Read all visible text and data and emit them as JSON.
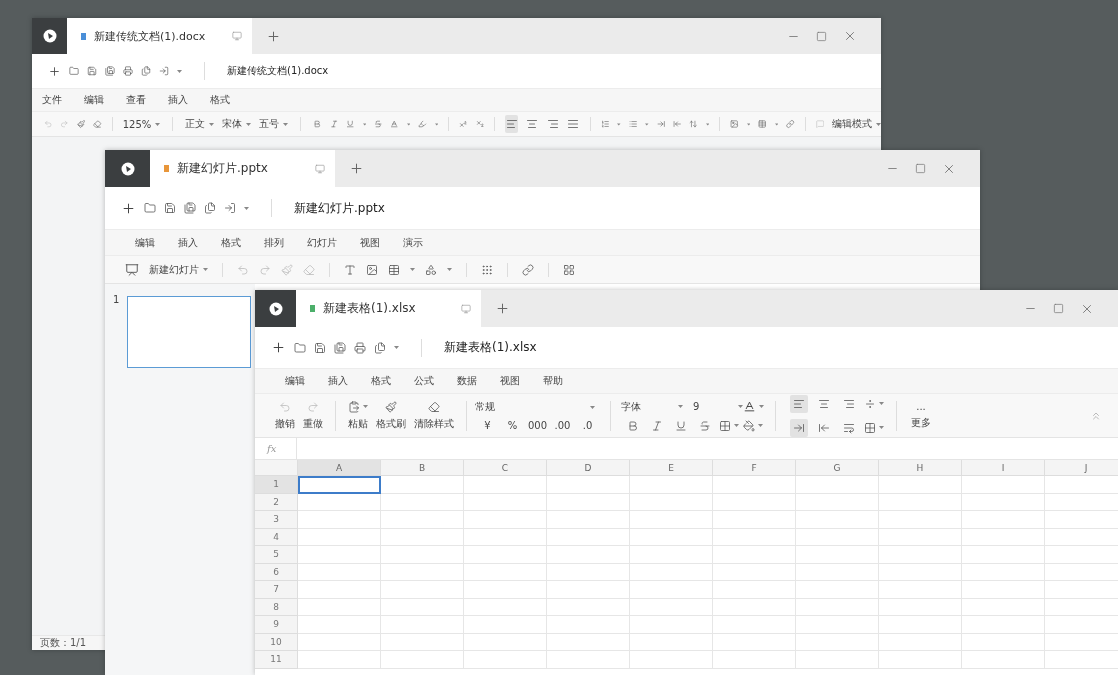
{
  "document_window": {
    "tab": {
      "title": "新建传统文档(1).docx",
      "color": "#4a8fd8"
    },
    "file_name": "新建传统文档(1).docx",
    "menu": [
      "文件",
      "编辑",
      "查看",
      "插入",
      "格式"
    ],
    "zoom": "125%",
    "paragraph_style": "正文",
    "font": "宋体",
    "font_size": "五号",
    "align_buttons": [
      {
        "selected": true
      },
      {
        "selected": false
      },
      {
        "selected": false
      },
      {
        "selected": false
      }
    ],
    "mode": "编辑模式",
    "status": "页数：1/1"
  },
  "presentation_window": {
    "tab": {
      "title": "新建幻灯片.pptx",
      "color": "#e8963a"
    },
    "file_name": "新建幻灯片.pptx",
    "menu": [
      "编辑",
      "插入",
      "格式",
      "排列",
      "幻灯片",
      "视图",
      "演示"
    ],
    "new_slide": "新建幻灯片",
    "slides": [
      {
        "number": "1",
        "selected": true
      }
    ]
  },
  "spreadsheet_window": {
    "tab": {
      "title": "新建表格(1).xlsx",
      "color": "#4caf6a"
    },
    "file_name": "新建表格(1).xlsx",
    "menu": [
      "编辑",
      "插入",
      "格式",
      "公式",
      "数据",
      "视图",
      "帮助"
    ],
    "ribbon": {
      "undo": "撤销",
      "redo": "重做",
      "paste": "粘贴",
      "format_painter": "格式刷",
      "clear": "清除样式",
      "number_format": "常规",
      "currency": "¥",
      "percent": "%",
      "thousands": "000",
      "decimal_more": ".00",
      "decimal_less": ".0",
      "font": "字体",
      "font_size": "9",
      "more_dots": "...",
      "more": "更多"
    },
    "align_buttons": [
      {
        "selected": true
      },
      {
        "selected": false
      },
      {
        "selected": false
      },
      {
        "selected": true
      },
      {
        "selected": false
      },
      {
        "selected": false
      }
    ],
    "formula_label": "fx",
    "columns": [
      {
        "label": "A",
        "selected": true
      },
      {
        "label": "B",
        "selected": false
      },
      {
        "label": "C",
        "selected": false
      },
      {
        "label": "D",
        "selected": false
      },
      {
        "label": "E",
        "selected": false
      },
      {
        "label": "F",
        "selected": false
      },
      {
        "label": "G",
        "selected": false
      },
      {
        "label": "H",
        "selected": false
      },
      {
        "label": "I",
        "selected": false
      },
      {
        "label": "J",
        "selected": false
      }
    ],
    "rows": [
      {
        "label": "1",
        "selected": true
      },
      {
        "label": "2",
        "selected": false
      },
      {
        "label": "3",
        "selected": false
      },
      {
        "label": "4",
        "selected": false
      },
      {
        "label": "5",
        "selected": false
      },
      {
        "label": "6",
        "selected": false
      },
      {
        "label": "7",
        "selected": false
      },
      {
        "label": "8",
        "selected": false
      },
      {
        "label": "9",
        "selected": false
      },
      {
        "label": "10",
        "selected": false
      },
      {
        "label": "11",
        "selected": false
      }
    ]
  }
}
